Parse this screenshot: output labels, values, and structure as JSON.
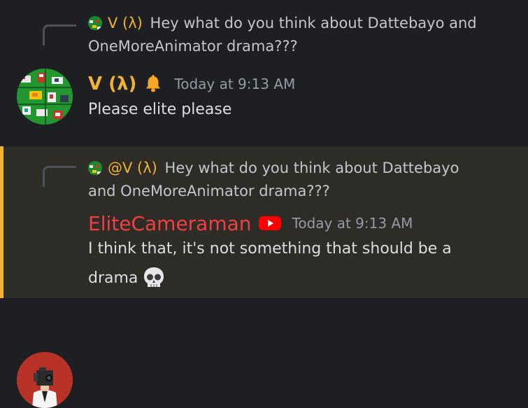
{
  "messages": [
    {
      "reply": {
        "author": "V (λ)",
        "text": "Hey what do you think about Dattebayo and OneMoreAnimator drama???"
      },
      "author": "V (λ)",
      "badge_icon": "bell-icon",
      "timestamp": "Today at 9:13 AM",
      "content": "Please elite please",
      "author_color": "#f0b232"
    },
    {
      "highlighted": true,
      "reply": {
        "author": "@V (λ)",
        "text": "Hey what do you think about Dattebayo and OneMoreAnimator drama???"
      },
      "author": "EliteCameraman",
      "badge_icon": "youtube-icon",
      "timestamp": "Today at 9:13 AM",
      "content": "I think that, it's not something that should be a drama",
      "emoji": "skull-emoji",
      "author_color": "#f23f43"
    }
  ],
  "colors": {
    "background": "#1e1f22",
    "highlight_background": "#2e2c27",
    "mention_bar": "#f0b232",
    "timestamp": "#949ba4"
  }
}
